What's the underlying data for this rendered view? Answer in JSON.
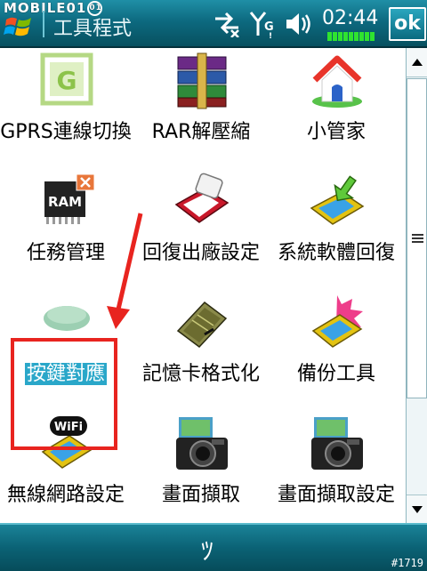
{
  "titlebar": {
    "brand": "MOBILE01",
    "brand_mark": "01",
    "title": "工具程式",
    "clock": "02:44",
    "ok_label": "ok"
  },
  "apps": [
    {
      "label": "GPRS連線切換",
      "icon": "gprs-switch-icon",
      "icon_letter": "G"
    },
    {
      "label": "RAR解壓縮",
      "icon": "rar-icon"
    },
    {
      "label": "小管家",
      "icon": "house-icon"
    },
    {
      "label": "任務管理",
      "icon": "ram-task-icon",
      "icon_letter": "RAM"
    },
    {
      "label": "回復出廠設定",
      "icon": "factory-reset-icon"
    },
    {
      "label": "系統軟體回復",
      "icon": "system-restore-icon"
    },
    {
      "label": "按鍵對應",
      "icon": "key-mapping-icon",
      "selected": true
    },
    {
      "label": "記憶卡格式化",
      "icon": "memory-card-icon"
    },
    {
      "label": "備份工具",
      "icon": "backup-icon"
    },
    {
      "label": "無線網路設定",
      "icon": "wifi-settings-icon",
      "icon_letter": "WiFi"
    },
    {
      "label": "畫面擷取",
      "icon": "camera-icon"
    },
    {
      "label": "畫面擷取設定",
      "icon": "camera-settings-icon"
    }
  ],
  "footer": {
    "back_glyph": "ﾂ",
    "watermark": "#1719"
  },
  "colors": {
    "titlebar": "#0d6a80",
    "selection": "#2aa7c9",
    "annotation": "#e8241f",
    "battery": "#2fe32f"
  }
}
